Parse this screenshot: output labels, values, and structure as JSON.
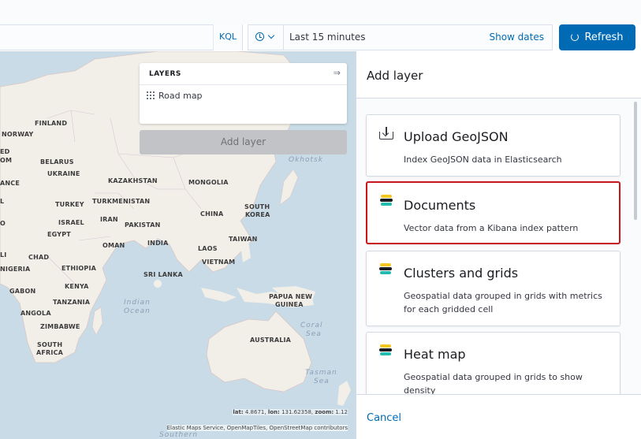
{
  "query": {
    "language_label": "KQL",
    "date_range": "Last 15 minutes",
    "show_dates_label": "Show dates",
    "refresh_label": "Refresh"
  },
  "layers_panel": {
    "title": "LAYERS",
    "items": [
      {
        "label": "Road map",
        "icon": "grid-icon"
      }
    ],
    "add_layer_label": "Add layer"
  },
  "map": {
    "labels": {
      "finland": "FINLAND",
      "norway": "NORWAY",
      "ed": "ED",
      "om": "OM",
      "belarus": "BELARUS",
      "ukraine": "UKRAINE",
      "ance": "ANCE",
      "kazakhstan": "KAZAKHSTAN",
      "mongolia": "MONGOLIA",
      "turkey": "TURKEY",
      "turkmenistan": "TURKMENISTAN",
      "iran": "IRAN",
      "israel": "ISRAEL",
      "pakistan": "PAKISTAN",
      "china": "CHINA",
      "south_korea_1": "SOUTH",
      "south_korea_2": "KOREA",
      "egypt": "EGYPT",
      "oman": "OMAN",
      "india": "INDIA",
      "taiwan": "TAIWAN",
      "laos": "LAOS",
      "vietnam": "VIETNAM",
      "chad": "CHAD",
      "li": "LI",
      "nigeria": "NIGERIA",
      "ethiopia": "ETHIOPIA",
      "sri_lanka": "SRI LANKA",
      "kenya": "KENYA",
      "gabon": "GABON",
      "tanzania": "TANZANIA",
      "png_1": "PAPUA NEW",
      "png_2": "GUINEA",
      "angola": "ANGOLA",
      "zimbabwe": "ZIMBABWE",
      "australia": "AUSTRALIA",
      "south_africa_1": "SOUTH",
      "south_africa_2": "AFRICA",
      "o": "O",
      "l": "L"
    },
    "oceans": {
      "okhotsk": "Okhotsk",
      "indian_1": "Indian",
      "indian_2": "Ocean",
      "coral_1": "Coral",
      "coral_2": "Sea",
      "tasman_1": "Tasman",
      "tasman_2": "Sea",
      "southern": "Southern"
    },
    "coords": {
      "lat_label": "lat:",
      "lat": "4.8671",
      "lon_label": "lon:",
      "lon": "131.62358",
      "zoom_label": "zoom:",
      "zoom": "1.12"
    },
    "attribution": "Elastic Maps Service, OpenMapTiles, OpenStreetMap contributors"
  },
  "flyout": {
    "title": "Add layer",
    "cards": [
      {
        "title": "Upload GeoJSON",
        "description": "Index GeoJSON data in Elasticsearch",
        "icon": "upload-icon",
        "selected": false
      },
      {
        "title": "Documents",
        "description": "Vector data from a Kibana index pattern",
        "icon": "elastic-icon",
        "selected": true
      },
      {
        "title": "Clusters and grids",
        "description": "Geospatial data grouped in grids with metrics for each gridded cell",
        "icon": "elastic-icon",
        "selected": false
      },
      {
        "title": "Heat map",
        "description": "Geospatial data grouped in grids to show density",
        "icon": "elastic-icon",
        "selected": false
      }
    ],
    "cancel_label": "Cancel"
  },
  "colors": {
    "primary": "#006bb4",
    "selected_outline": "#c8161d",
    "land": "#f2efe9",
    "water": "#c9dbe6"
  }
}
